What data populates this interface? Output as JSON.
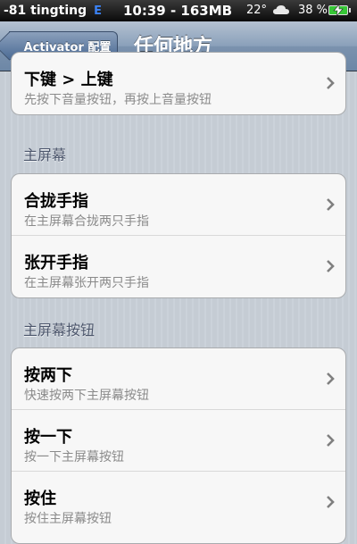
{
  "status_bar": {
    "carrier": "-81 tingting",
    "network": "E",
    "time": "10:39 - 163MB",
    "temperature": "22°",
    "battery": "38 %"
  },
  "nav": {
    "back_label": "Activator 配置",
    "title": "任何地方"
  },
  "top_group": {
    "items": [
      {
        "title": "下键 > 上键",
        "subtitle": "先按下音量按钮，再按上音量按钮"
      }
    ]
  },
  "home_screen": {
    "header": "主屏幕",
    "items": [
      {
        "title": "合拢手指",
        "subtitle": "在主屏幕合拢两只手指"
      },
      {
        "title": "张开手指",
        "subtitle": "在主屏幕张开两只手指"
      }
    ]
  },
  "home_button": {
    "header": "主屏幕按钮",
    "items": [
      {
        "title": "按两下",
        "subtitle": "快速按两下主屏幕按钮"
      },
      {
        "title": "按一下",
        "subtitle": "按一下主屏幕按钮"
      },
      {
        "title": "按住",
        "subtitle": "按住主屏幕按钮"
      }
    ]
  }
}
